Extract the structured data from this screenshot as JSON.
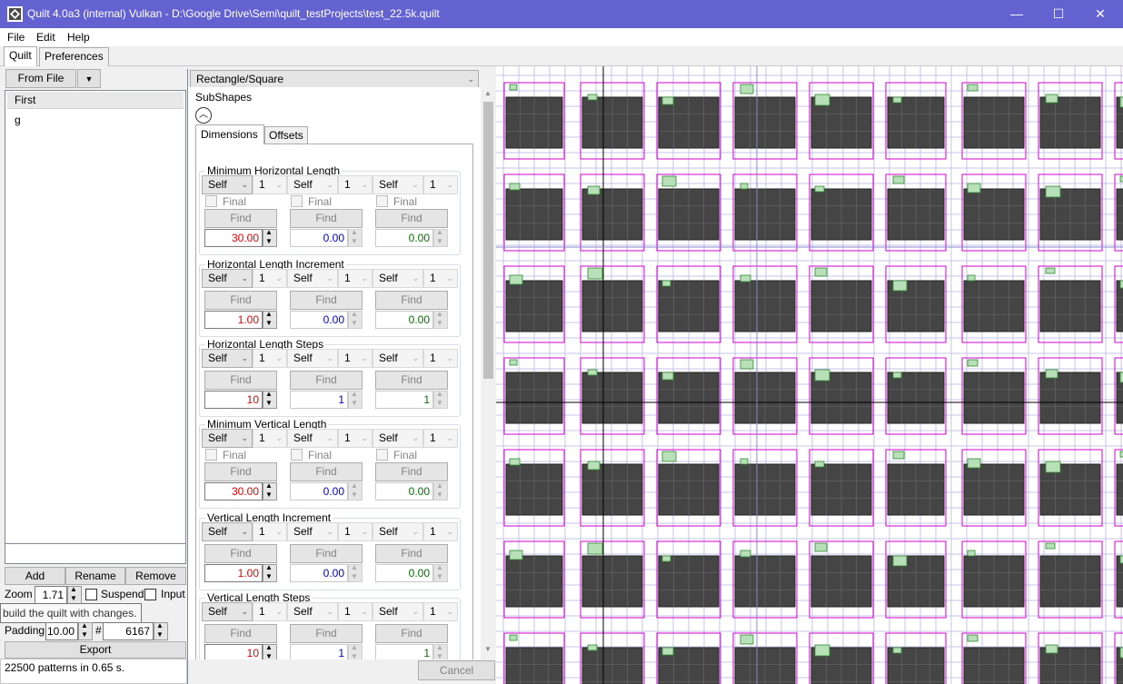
{
  "window": {
    "title": "Quilt 4.0a3 (internal) Vulkan - D:\\Google Drive\\Semi\\quilt_testProjects\\test_22.5k.quilt",
    "minimize": "—",
    "maximize": "☐",
    "close": "✕"
  },
  "menu": {
    "file": "File",
    "edit": "Edit",
    "help": "Help"
  },
  "tabs": {
    "quilt": "Quilt",
    "preferences": "Preferences"
  },
  "left": {
    "from_file": "From File",
    "list_header": "First",
    "list_items": [
      "g"
    ],
    "add": "Add",
    "rename": "Rename",
    "remove": "Remove",
    "zoom_label": "Zoom",
    "zoom_value": "1.71",
    "suspend_label": "Suspend",
    "input_label": "Input",
    "tooltip": "build the quilt with changes.",
    "padding_label": "Padding",
    "padding_value": "10.00",
    "hash_label": "#",
    "hash_value": "6167",
    "export": "Export",
    "status": "22500 patterns in 0.65 s."
  },
  "middle": {
    "shape": "Rectangle/Square",
    "subshapes": "SubShapes",
    "tab_dimensions": "Dimensions",
    "tab_offsets": "Offsets",
    "cancel": "Cancel",
    "combo_self": "Self",
    "combo_one": "1",
    "final": "Final",
    "find": "Find",
    "groups": [
      {
        "label": "Minimum Horizontal Length",
        "final": true,
        "values": [
          "30.00",
          "0.00",
          "0.00"
        ]
      },
      {
        "label": "Horizontal Length Increment",
        "final": false,
        "values": [
          "1.00",
          "0.00",
          "0.00"
        ]
      },
      {
        "label": "Horizontal Length Steps",
        "final": false,
        "values": [
          "10",
          "1",
          "1"
        ]
      },
      {
        "label": "Minimum Vertical Length",
        "final": true,
        "values": [
          "30.00",
          "0.00",
          "0.00"
        ]
      },
      {
        "label": "Vertical Length Increment",
        "final": false,
        "values": [
          "1.00",
          "0.00",
          "0.00"
        ]
      },
      {
        "label": "Vertical Length Steps",
        "final": false,
        "values": [
          "10",
          "1",
          "1"
        ]
      }
    ],
    "value_colors": [
      "#e00000",
      "#0000d0",
      "#007000"
    ]
  },
  "canvas": {
    "columns": 9,
    "rows": 7,
    "cell_fill": "#454545",
    "outline": "#d000d0",
    "marker_fill": "#b8e0b8",
    "marker_stroke": "#2e8b2e",
    "grid": "#c4c4e8",
    "axis": "#000000"
  }
}
